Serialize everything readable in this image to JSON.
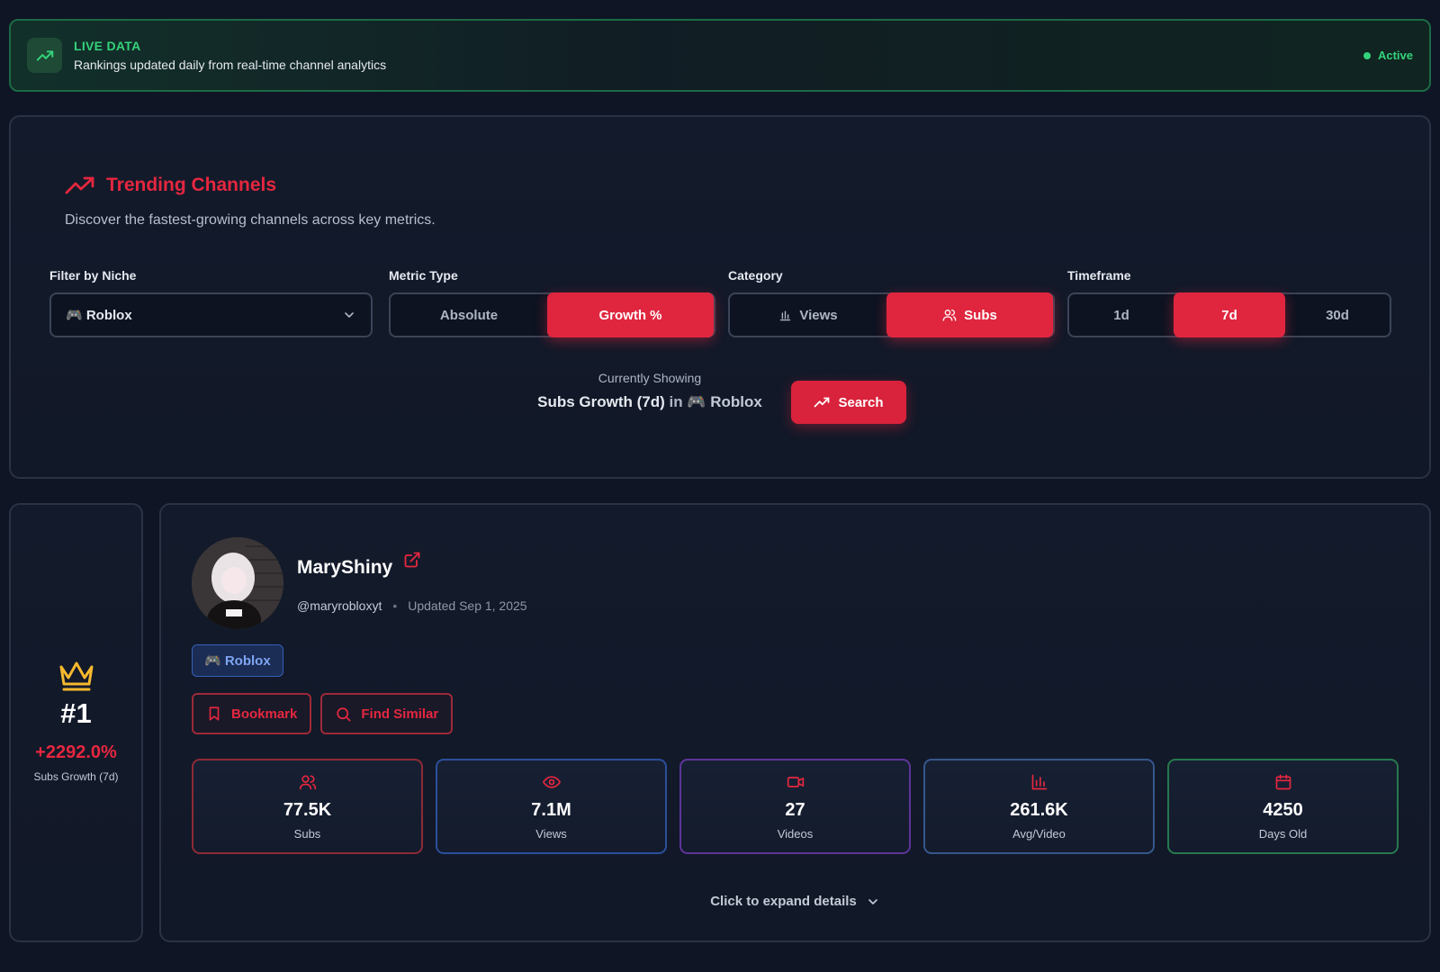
{
  "banner": {
    "title": "LIVE DATA",
    "subtitle": "Rankings updated daily from real-time channel analytics",
    "status": "Active",
    "icon": "trending-up-icon",
    "accent": "#34d27b"
  },
  "header": {
    "title": "Trending Channels",
    "description": "Discover the fastest-growing channels across key metrics.",
    "accent": "#e5273f"
  },
  "filters": {
    "niche": {
      "label": "Filter by Niche",
      "value": "🎮 Roblox"
    },
    "metric_type": {
      "label": "Metric Type",
      "options": [
        "Absolute",
        "Growth %"
      ],
      "selected": "Growth %"
    },
    "category": {
      "label": "Category",
      "options": [
        "Views",
        "Subs"
      ],
      "selected": "Subs"
    },
    "timeframe": {
      "label": "Timeframe",
      "options": [
        "1d",
        "7d",
        "30d"
      ],
      "selected": "7d"
    }
  },
  "showing": {
    "label": "Currently Showing",
    "metric": "Subs Growth (7d)",
    "in": "in",
    "niche": "🎮 Roblox"
  },
  "search_button": "Search",
  "rank": {
    "position": "#1",
    "growth": "+2292.0%",
    "label": "Subs Growth (7d)",
    "crown_color": "#f5b82e"
  },
  "channel": {
    "name": "MaryShiny",
    "handle": "@maryrobloxyt",
    "separator": "•",
    "updated": "Updated Sep 1, 2025",
    "niche_badge": "🎮 Roblox",
    "actions": {
      "bookmark": "Bookmark",
      "find_similar": "Find Similar"
    },
    "stats": [
      {
        "icon": "users-icon",
        "value": "77.5K",
        "label": "Subs",
        "color": "#b8303f"
      },
      {
        "icon": "eye-icon",
        "value": "7.1M",
        "label": "Views",
        "color": "#2d5bb0"
      },
      {
        "icon": "video-icon",
        "value": "27",
        "label": "Videos",
        "color": "#6b3bb0"
      },
      {
        "icon": "bar-chart-icon",
        "value": "261.6K",
        "label": "Avg/Video",
        "color": "#3d5f9a"
      },
      {
        "icon": "calendar-icon",
        "value": "4250",
        "label": "Days Old",
        "color": "#2b8a57"
      }
    ],
    "expand_label": "Click to expand details"
  }
}
